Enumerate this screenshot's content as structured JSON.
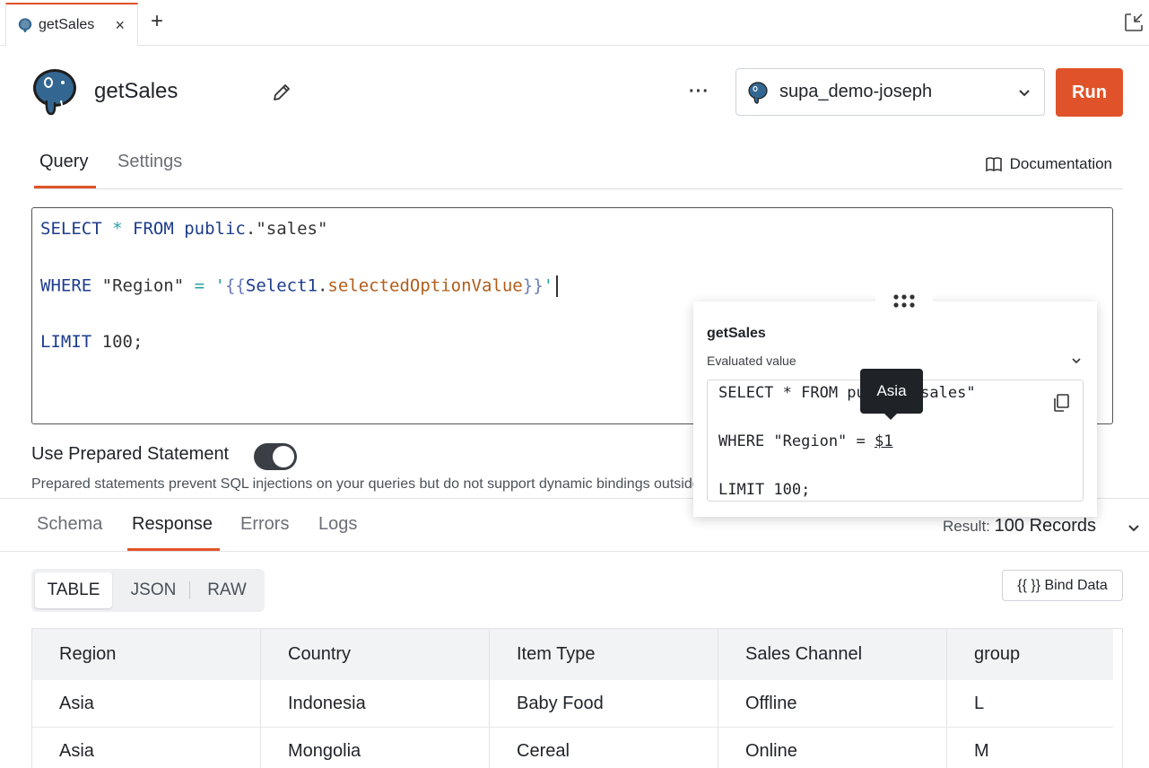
{
  "tabbar": {
    "tab_label": "getSales",
    "close_glyph": "×",
    "add_glyph": "+",
    "icons": [
      "postgres-icon",
      "close-icon",
      "plus-icon",
      "collapse-icon"
    ]
  },
  "header": {
    "query_name": "getSales",
    "more_glyph": "···",
    "datasource": "supa_demo-joseph",
    "run_label": "Run",
    "icons": [
      "postgres-logo-icon",
      "pencil-icon",
      "more-icon",
      "chevron-down-icon"
    ]
  },
  "query_tabs": {
    "tabs": [
      {
        "label": "Query",
        "active": true
      },
      {
        "label": "Settings",
        "active": false
      }
    ],
    "documentation_label": "Documentation"
  },
  "editor": {
    "line1": {
      "kw1": "SELECT",
      "op": "*",
      "kw2": "FROM",
      "schema": "public",
      "dot": ".",
      "table": "\"sales\""
    },
    "line2": {
      "kw": "WHERE",
      "col": "\"Region\"",
      "eq": "=",
      "open_quote": "'",
      "open_brace": "{{",
      "obj": "Select1",
      "dot": ".",
      "prop": "selectedOptionValue",
      "close_brace": "}}",
      "close_quote": "'"
    },
    "line3": {
      "kw": "LIMIT",
      "num": "100;"
    }
  },
  "prepared": {
    "label": "Use Prepared Statement",
    "enabled": true,
    "hint": "Prepared statements prevent SQL injections on your queries but do not support dynamic bindings outside values in your SQL"
  },
  "response_tabs": {
    "tabs": [
      {
        "label": "Schema",
        "active": false
      },
      {
        "label": "Response",
        "active": true
      },
      {
        "label": "Errors",
        "active": false
      },
      {
        "label": "Logs",
        "active": false
      }
    ],
    "result_prefix": "Result:",
    "result_value": "100 Records"
  },
  "view_toggle": {
    "options": [
      "TABLE",
      "JSON",
      "RAW"
    ],
    "selected": "TABLE"
  },
  "bind_data_label": "{{ }} Bind Data",
  "table": {
    "columns": [
      "Region",
      "Country",
      "Item Type",
      "Sales Channel",
      "group"
    ],
    "rows": [
      [
        "Asia",
        "Indonesia",
        "Baby Food",
        "Offline",
        "L"
      ],
      [
        "Asia",
        "Mongolia",
        "Cereal",
        "Online",
        "M"
      ]
    ]
  },
  "evaluated": {
    "title": "getSales",
    "subtitle": "Evaluated value",
    "line1": "SELECT * FROM public.\"sales\"",
    "line2_prefix": "WHERE \"Region\" = ",
    "line2_param": "$1",
    "line3": "LIMIT 100;",
    "tooltip": "Asia",
    "icons": [
      "drag-handle-icon",
      "chevron-down-icon",
      "copy-icon"
    ]
  },
  "colors": {
    "accent": "#e0532a",
    "keyword": "#1c3c8c",
    "binding_property": "#b25d1a",
    "toggle_on": "#3b3f45"
  }
}
